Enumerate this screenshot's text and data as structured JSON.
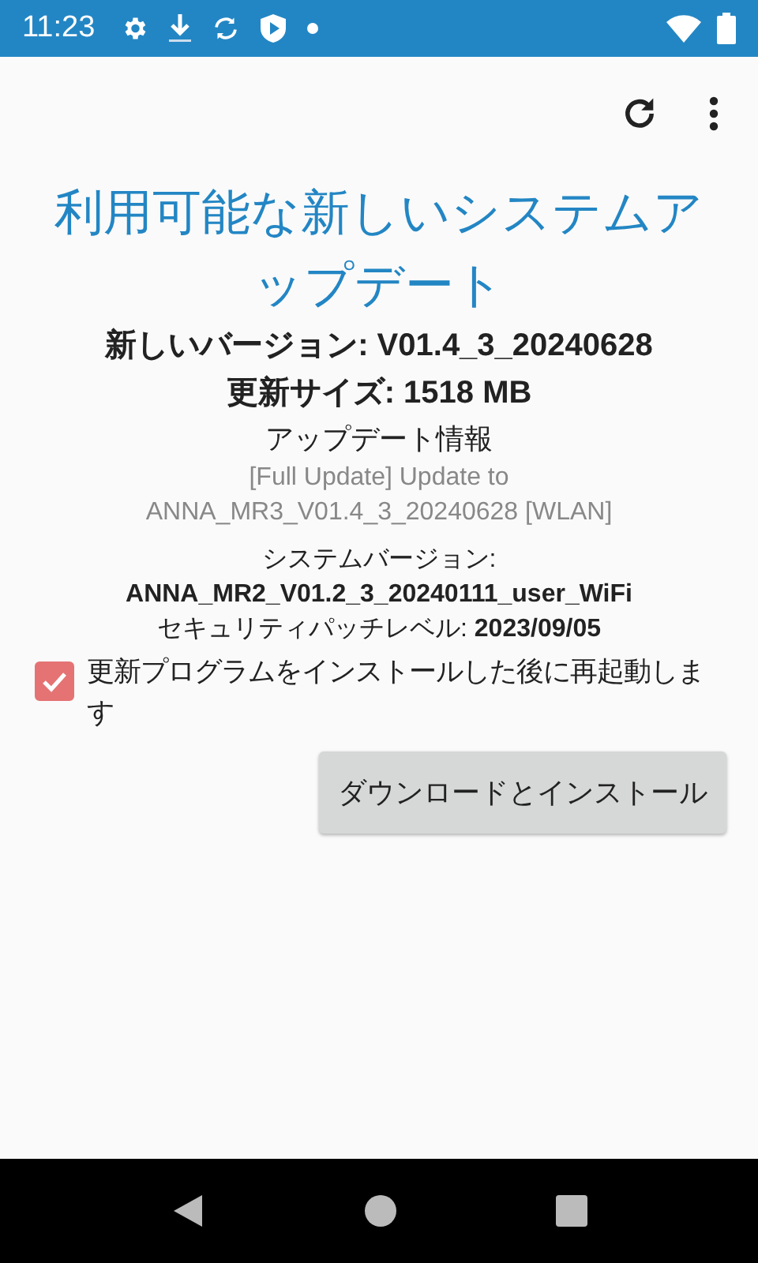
{
  "status_bar": {
    "time": "11:23"
  },
  "title": "利用可能な新しいシステムアップデート",
  "new_version": "新しいバージョン: V01.4_3_20240628",
  "update_size": "更新サイズ: 1518 MB",
  "info_heading": "アップデート情報",
  "info_text": "[Full Update] Update to ANNA_MR3_V01.4_3_20240628 [WLAN]",
  "system_version_label": "システムバージョン:",
  "system_version_value": "ANNA_MR2_V01.2_3_20240111_user_WiFi",
  "security_patch": "セキュリティパッチレベル: **2023/09/05**",
  "restart_option": {
    "label": "更新プログラムをインストールした後に再起動します",
    "checked": true
  },
  "install_button": "ダウンロードとインストール"
}
